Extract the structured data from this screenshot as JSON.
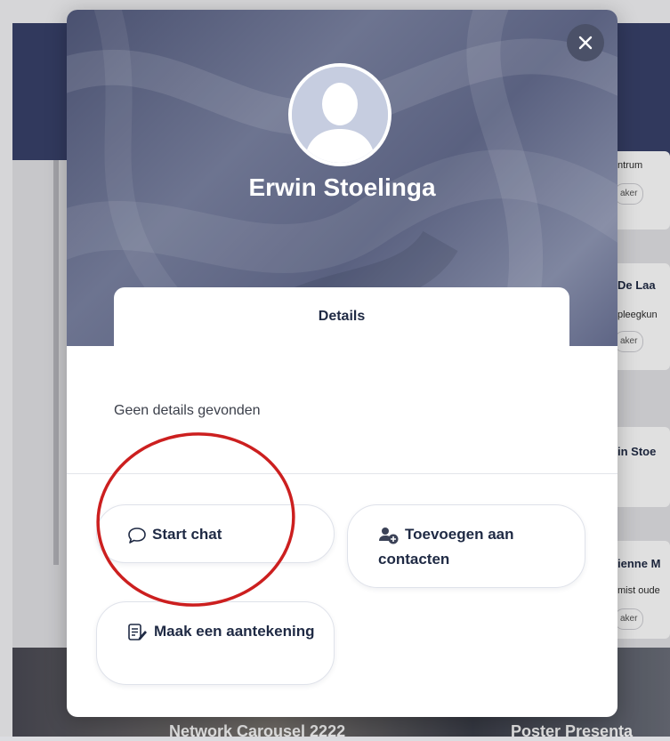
{
  "background": {
    "card_snippets": [
      "ntrum",
      "aker",
      "De Laa",
      "pleegkun",
      "aker",
      "in Stoe",
      "ienne M",
      "mist oude",
      "aker"
    ],
    "captions": [
      "Network Carousel 2222",
      "Poster Presenta"
    ]
  },
  "profile": {
    "name": "Erwin Stoelinga",
    "avatar_icon": "person-silhouette-icon"
  },
  "modal": {
    "close_icon": "close-icon",
    "tabs": [
      {
        "label": "Details",
        "active": true
      }
    ],
    "details_empty_text": "Geen details gevonden"
  },
  "actions": {
    "start_chat": {
      "label": "Start chat",
      "icon": "chat-bubble-icon"
    },
    "add_contact": {
      "label": "Toevoegen aan contacten",
      "icon": "add-user-icon"
    },
    "make_note": {
      "label": "Maak een aantekening",
      "icon": "note-edit-icon"
    }
  },
  "colors": {
    "primary_text": "#1f2a44",
    "hero": "#5f6686",
    "annotation_circle": "#cc1f1f"
  }
}
